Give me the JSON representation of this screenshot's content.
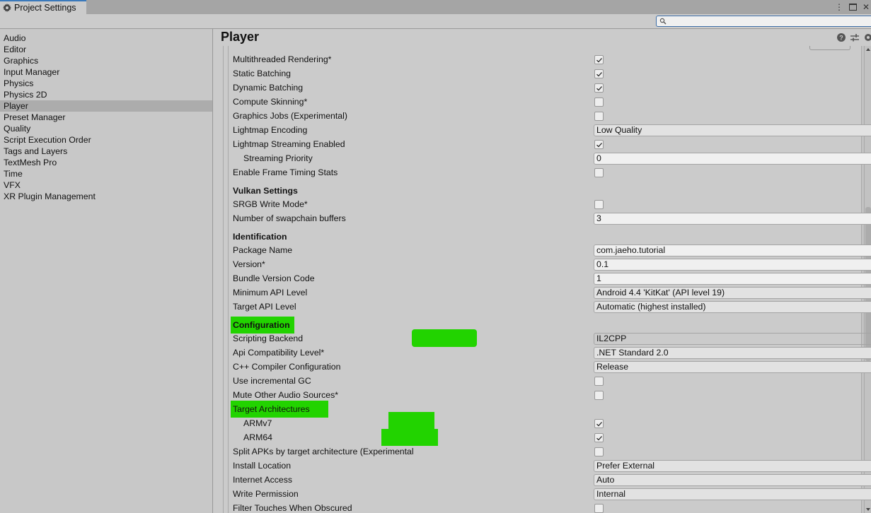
{
  "window": {
    "tab_title": "Project Settings",
    "menu_glyph": "⋮",
    "close_glyph": "✕"
  },
  "search": {
    "placeholder": "",
    "value": ""
  },
  "sidebar": {
    "items": [
      {
        "label": "Audio",
        "active": false
      },
      {
        "label": "Editor",
        "active": false
      },
      {
        "label": "Graphics",
        "active": false
      },
      {
        "label": "Input Manager",
        "active": false
      },
      {
        "label": "Physics",
        "active": false
      },
      {
        "label": "Physics 2D",
        "active": false
      },
      {
        "label": "Player",
        "active": true
      },
      {
        "label": "Preset Manager",
        "active": false
      },
      {
        "label": "Quality",
        "active": false
      },
      {
        "label": "Script Execution Order",
        "active": false
      },
      {
        "label": "Tags and Layers",
        "active": false
      },
      {
        "label": "TextMesh Pro",
        "active": false
      },
      {
        "label": "Time",
        "active": false
      },
      {
        "label": "VFX",
        "active": false
      },
      {
        "label": "XR Plugin Management",
        "active": false
      }
    ]
  },
  "main": {
    "title": "Player",
    "header_icons": [
      "help-icon",
      "presets-icon",
      "settings-gear-icon"
    ],
    "settings": [
      {
        "label": "Multithreaded Rendering*",
        "type": "checkbox",
        "checked": true
      },
      {
        "label": "Static Batching",
        "type": "checkbox",
        "checked": true
      },
      {
        "label": "Dynamic Batching",
        "type": "checkbox",
        "checked": true
      },
      {
        "label": "Compute Skinning*",
        "type": "checkbox",
        "checked": false
      },
      {
        "label": "Graphics Jobs (Experimental)",
        "type": "checkbox",
        "checked": false
      },
      {
        "label": "Lightmap Encoding",
        "type": "dropdown",
        "value": "Low Quality"
      },
      {
        "label": "Lightmap Streaming Enabled",
        "type": "checkbox",
        "checked": true
      },
      {
        "label": "Streaming Priority",
        "type": "field",
        "value": "0",
        "indent": true
      },
      {
        "label": "Enable Frame Timing Stats",
        "type": "checkbox",
        "checked": false
      },
      {
        "label": "Vulkan Settings",
        "type": "header"
      },
      {
        "label": "SRGB Write Mode*",
        "type": "checkbox",
        "checked": false
      },
      {
        "label": "Number of swapchain buffers",
        "type": "field",
        "value": "3"
      },
      {
        "label": "Identification",
        "type": "header"
      },
      {
        "label": "Package Name",
        "type": "field",
        "value": "com.jaeho.tutorial"
      },
      {
        "label": "Version*",
        "type": "field",
        "value": "0.1"
      },
      {
        "label": "Bundle Version Code",
        "type": "field",
        "value": "1"
      },
      {
        "label": "Minimum API Level",
        "type": "dropdown",
        "value": "Android 4.4 'KitKat' (API level 19)"
      },
      {
        "label": "Target API Level",
        "type": "dropdown",
        "value": "Automatic (highest installed)"
      },
      {
        "label": "Configuration",
        "type": "header",
        "highlight": true
      },
      {
        "label": "Scripting Backend",
        "type": "dropdown",
        "value": "IL2CPP",
        "highlight": true
      },
      {
        "label": "Api Compatibility Level*",
        "type": "dropdown",
        "value": ".NET Standard 2.0"
      },
      {
        "label": "C++ Compiler Configuration",
        "type": "dropdown",
        "value": "Release"
      },
      {
        "label": "Use incremental GC",
        "type": "checkbox",
        "checked": false
      },
      {
        "label": "Mute Other Audio Sources*",
        "type": "checkbox",
        "checked": false
      },
      {
        "label": "Target Architectures",
        "type": "label",
        "highlight": true
      },
      {
        "label": "ARMv7",
        "type": "checkbox",
        "checked": true,
        "indent": true,
        "highlight": true
      },
      {
        "label": "ARM64",
        "type": "checkbox",
        "checked": true,
        "indent": true,
        "highlight": true
      },
      {
        "label": "Split APKs by target architecture (Experimental)",
        "type": "checkbox",
        "checked": false
      },
      {
        "label": "Install Location",
        "type": "dropdown",
        "value": "Prefer External"
      },
      {
        "label": "Internet Access",
        "type": "dropdown",
        "value": "Auto"
      },
      {
        "label": "Write Permission",
        "type": "dropdown",
        "value": "Internal"
      },
      {
        "label": "Filter Touches When Obscured",
        "type": "checkbox",
        "checked": false
      }
    ]
  },
  "colors": {
    "highlight": "#22d300",
    "tab_accent": "#3a79bb",
    "selected_item": "#acacac"
  }
}
